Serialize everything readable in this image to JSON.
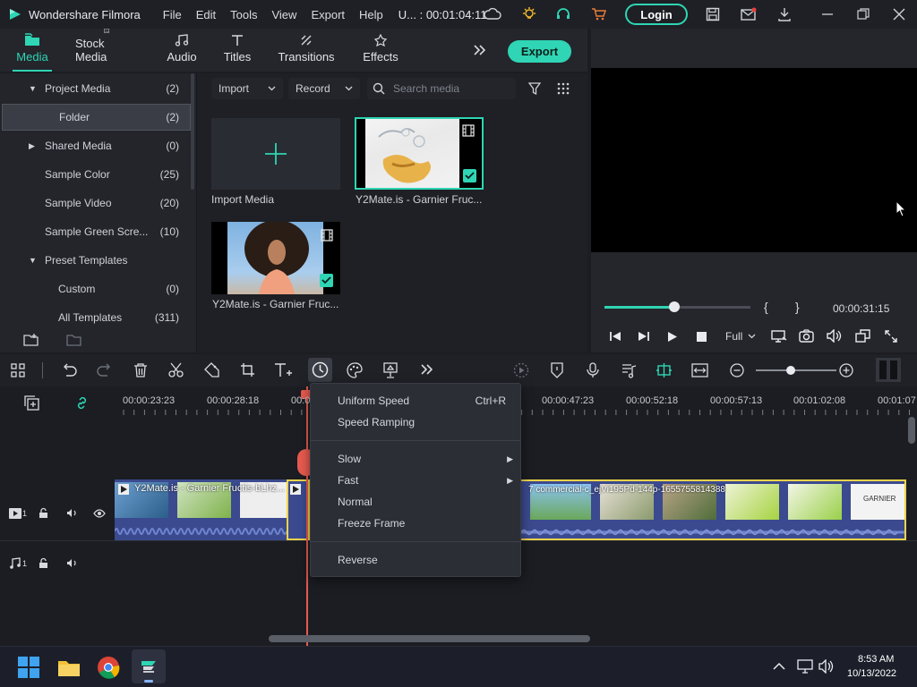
{
  "titlebar": {
    "app_name": "Wondershare Filmora",
    "menus": [
      "File",
      "Edit",
      "Tools",
      "View",
      "Export",
      "Help"
    ],
    "project": "U... : 00:01:04:11",
    "login": "Login"
  },
  "tabs": [
    "Media",
    "Stock Media",
    "Audio",
    "Titles",
    "Transitions",
    "Effects"
  ],
  "export_label": "Export",
  "tree": [
    {
      "label": "Project Media",
      "count": "(2)"
    },
    {
      "label": "Folder",
      "count": "(2)"
    },
    {
      "label": "Shared Media",
      "count": "(0)"
    },
    {
      "label": "Sample Color",
      "count": "(25)"
    },
    {
      "label": "Sample Video",
      "count": "(20)"
    },
    {
      "label": "Sample Green Scre...",
      "count": "(10)"
    },
    {
      "label": "Preset Templates",
      "count": ""
    },
    {
      "label": "Custom",
      "count": "(0)"
    },
    {
      "label": "All Templates",
      "count": "(311)"
    }
  ],
  "media_toolbar": {
    "import": "Import",
    "record": "Record",
    "search_placeholder": "Search media"
  },
  "media_items": [
    {
      "label": "Import Media"
    },
    {
      "label": "Y2Mate.is - Garnier Fruc..."
    },
    {
      "label": "Y2Mate.is - Garnier Fruc..."
    }
  ],
  "preview": {
    "timecode": "00:00:31:15",
    "quality": "Full",
    "progress": 0.48,
    "brace_open": "{",
    "brace_close": "}"
  },
  "ruler": [
    "00:00:23:23",
    "00:00:28:18",
    "00:0",
    "00:00:47:23",
    "00:00:52:18",
    "00:00:57:13",
    "00:01:02:08",
    "00:01:07"
  ],
  "tracks": {
    "video_num": "1",
    "audio_num": "1",
    "clip1": "Y2Mate.is - Garnier Fructis-bLhz...",
    "clip3": "7 commercial-c_ejVi195Pd-144p-1655755814388",
    "clip_brand": "GARNIER"
  },
  "context_menu": {
    "uniform": "Uniform Speed",
    "uniform_sc": "Ctrl+R",
    "ramping": "Speed Ramping",
    "slow": "Slow",
    "fast": "Fast",
    "normal": "Normal",
    "freeze": "Freeze Frame",
    "reverse": "Reverse"
  },
  "taskbar": {
    "time": "8:53 AM",
    "date": "10/13/2022"
  },
  "colors": {
    "accent": "#2fd5b4",
    "playhead": "#e85a4f",
    "clip_border": "#f1d34a"
  }
}
